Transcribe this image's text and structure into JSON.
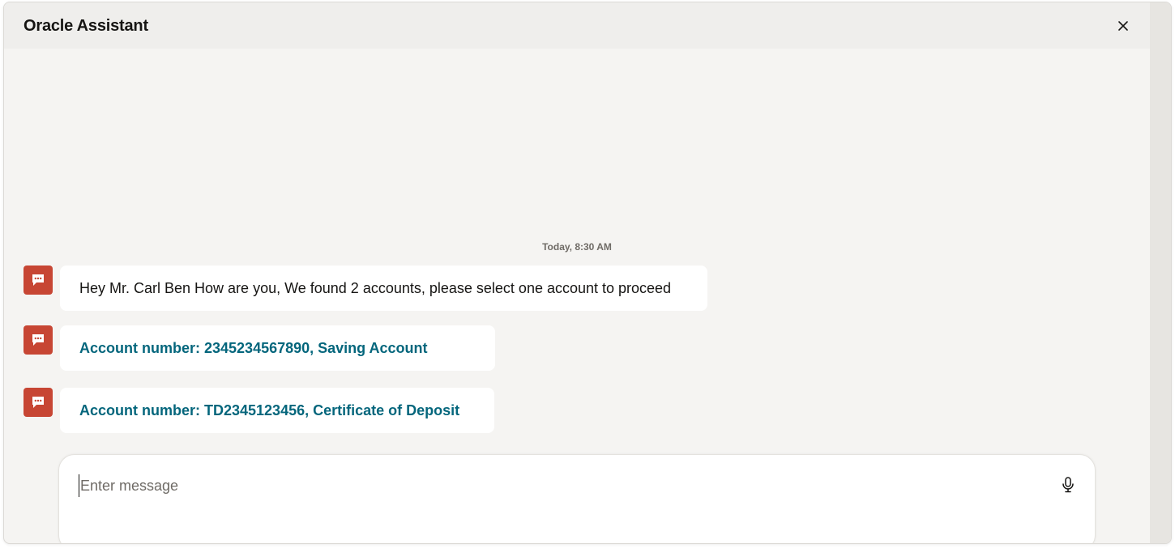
{
  "header": {
    "title": "Oracle Assistant",
    "close_icon": "close-icon"
  },
  "conversation": {
    "timestamp": "Today, 8:30 AM",
    "messages": [
      {
        "type": "text",
        "text": "Hey Mr. Carl Ben How are you, We found 2 accounts, please select one account to proceed",
        "avatar_icon": "chat-bubble-icon"
      },
      {
        "type": "action",
        "text": "Account number: 2345234567890, Saving Account",
        "avatar_icon": "chat-bubble-icon"
      },
      {
        "type": "action",
        "text": "Account number: TD2345123456, Certificate of Deposit",
        "avatar_icon": "chat-bubble-icon"
      }
    ]
  },
  "composer": {
    "placeholder": "Enter message",
    "value": "",
    "mic_icon": "microphone-icon"
  },
  "colors": {
    "avatar_bg": "#c74634",
    "action_text": "#04667c",
    "background": "#f5f4f2",
    "header_bg": "#efeeec"
  }
}
